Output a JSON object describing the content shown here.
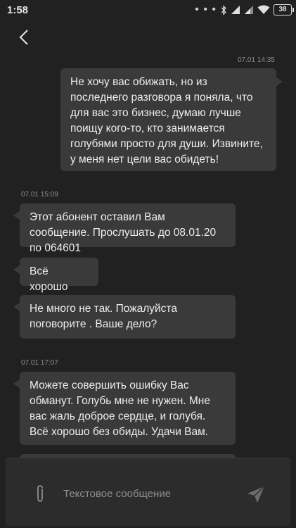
{
  "status": {
    "time": "1:58",
    "battery": "38",
    "dots": "• • •"
  },
  "messages": [
    {
      "timestamp": "07.01 14:35",
      "direction": "out",
      "text": "Не хочу вас обижать, но из последнего разговора я поняла, что для вас это бизнес, думаю лучше поищу кого-то, кто занимается голубями просто для души. Извините, у меня нет цели вас обидеть!"
    },
    {
      "timestamp": "07.01 15:09",
      "direction": "in",
      "text": "Этот абонент оставил Вам сообщение. Прослушать до 08.01.20 по 064601"
    },
    {
      "direction": "in",
      "text": "Всё хорошо"
    },
    {
      "direction": "in",
      "text": "Не много не так. Пожалуйста поговорите . Ваше дело?"
    },
    {
      "timestamp": "07.01 17:07",
      "direction": "in",
      "text": "Можете совершить ошибку Вас обманут. Голубь мне не нужен. Мне вас жаль  доброе сердце, и голубя. Всё хорошо без обиды. Удачи Вам."
    }
  ],
  "composer": {
    "placeholder": "Текстовое сообщение"
  }
}
